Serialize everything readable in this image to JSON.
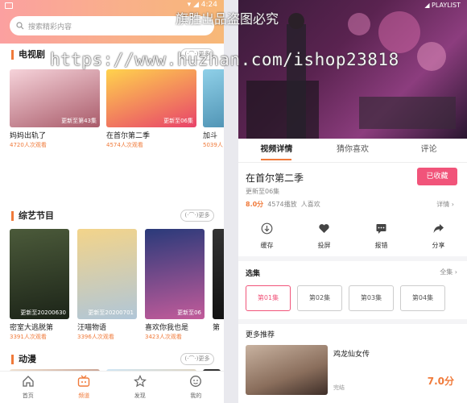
{
  "left": {
    "status": {
      "right": "▾ ◢ 4:24"
    },
    "search": {
      "placeholder": "搜索精彩内容"
    },
    "more_label": "(·⌒·)更多",
    "tv": {
      "title": "电视剧",
      "cards": [
        {
          "title": "妈妈出轨了",
          "badge": "更新至第43集",
          "views": "4720人次观看",
          "c1": "#f6d3da",
          "c2": "#a95b6a"
        },
        {
          "title": "在首尔第二季",
          "badge": "更新至06集",
          "views": "4574人次观看",
          "c1": "#ffd34d",
          "c2": "#e8436a"
        },
        {
          "title": "加斗",
          "badge": "",
          "views": "5039人",
          "c1": "#8fd0e8",
          "c2": "#3a7fa3"
        }
      ]
    },
    "variety": {
      "title": "综艺节目",
      "cards": [
        {
          "title": "密室大逃脱第",
          "badge": "更新至20200630",
          "views": "3391人次观看",
          "c1": "#4b5a3a",
          "c2": "#1c2418"
        },
        {
          "title": "汪喵物语",
          "badge": "更新至20200701",
          "views": "3396人次观看",
          "c1": "#f3d48a",
          "c2": "#b0c6d8"
        },
        {
          "title": "喜欢你我也是",
          "badge": "更新至06",
          "views": "3423人次观看",
          "c1": "#2a3a7a",
          "c2": "#c25b9a"
        },
        {
          "title": "第",
          "badge": "",
          "views": "",
          "c1": "#333333",
          "c2": "#111111"
        }
      ]
    },
    "anime": {
      "title": "动漫"
    },
    "tabs": [
      {
        "label": "首页",
        "icon": "home-icon"
      },
      {
        "label": "频道",
        "icon": "tv-icon"
      },
      {
        "label": "发现",
        "icon": "discover-icon"
      },
      {
        "label": "我的",
        "icon": "profile-icon"
      }
    ]
  },
  "right": {
    "status": {
      "right": "◢ PLAYLIST"
    },
    "tabs": [
      "视频详情",
      "猜你喜欢",
      "评论"
    ],
    "info": {
      "title": "在首尔第二季",
      "update": "更新至06集",
      "score": "8.0分",
      "stats": "4574播放",
      "likes": "人喜欢",
      "detail": "详情 ›",
      "fav": "已收藏"
    },
    "actions": [
      {
        "label": "缓存",
        "icon": "download-icon"
      },
      {
        "label": "投屏",
        "icon": "heart-icon"
      },
      {
        "label": "报错",
        "icon": "feedback-icon"
      },
      {
        "label": "分享",
        "icon": "share-icon"
      }
    ],
    "episodes": {
      "title": "选集",
      "all": "全集 ›",
      "items": [
        "第01集",
        "第02集",
        "第03集",
        "第04集"
      ]
    },
    "recommend": {
      "title": "更多推荐",
      "name": "鸡龙仙女传",
      "status": "完结",
      "score": "7.0分"
    }
  },
  "watermarks": {
    "url": "https://www.huzhan.com/ishop23818",
    "cn": "旗胜出品盗图必究"
  },
  "colors": {
    "accent": "#f07a3a",
    "fav": "#f1547a"
  }
}
